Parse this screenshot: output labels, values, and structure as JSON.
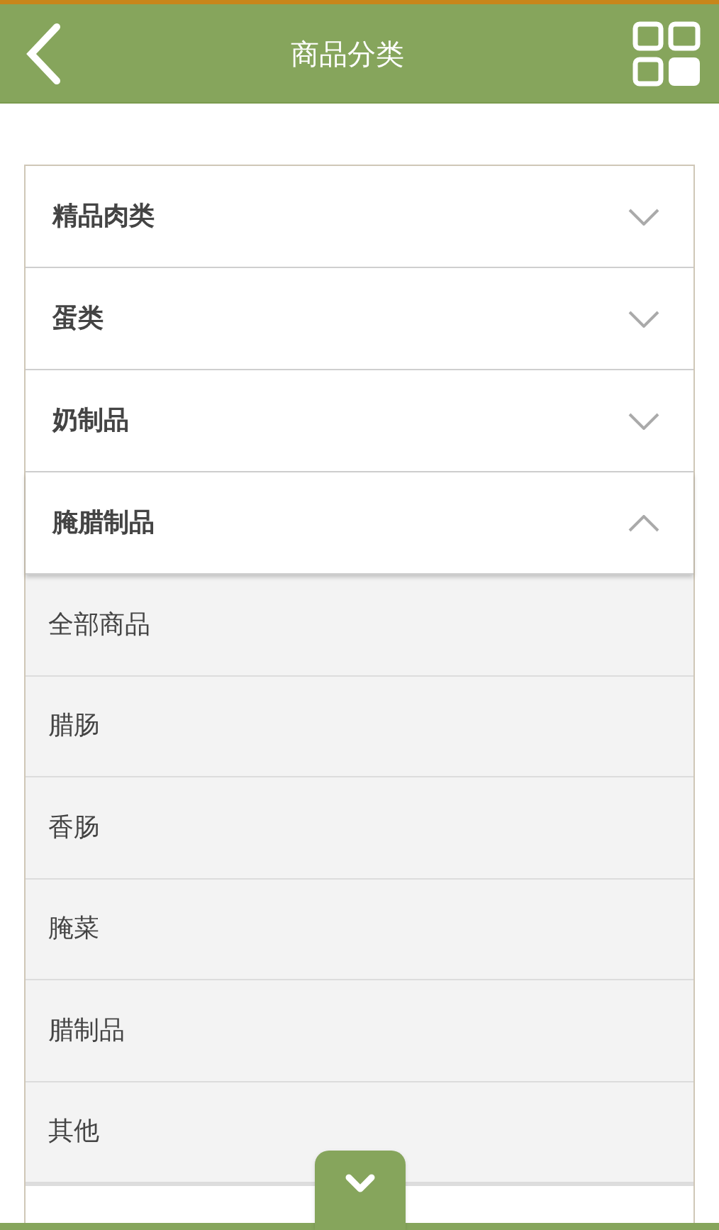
{
  "header": {
    "title": "商品分类"
  },
  "categories": [
    {
      "label": "精品肉类",
      "expanded": false
    },
    {
      "label": "蛋类",
      "expanded": false
    },
    {
      "label": "奶制品",
      "expanded": false
    },
    {
      "label": "腌腊制品",
      "expanded": true,
      "children": [
        {
          "label": "全部商品"
        },
        {
          "label": "腊肠"
        },
        {
          "label": "香肠"
        },
        {
          "label": "腌菜"
        },
        {
          "label": "腊制品"
        },
        {
          "label": "其他"
        }
      ]
    }
  ]
}
